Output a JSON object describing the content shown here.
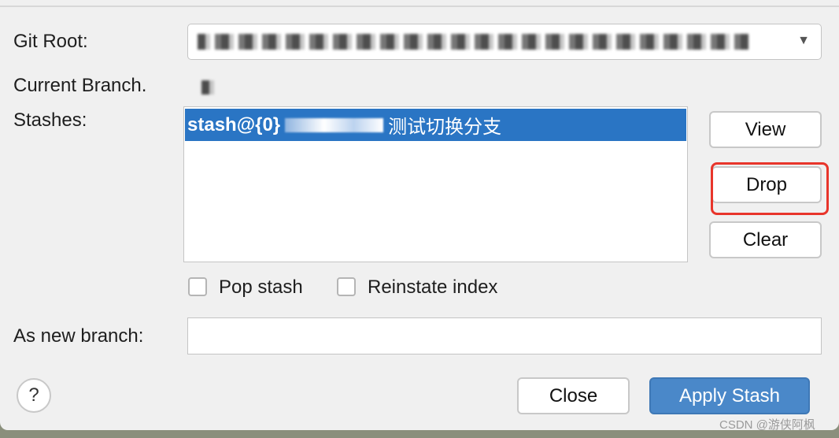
{
  "dialog": {
    "git_root_label": "Git Root:",
    "current_branch_label": "Current Branch.",
    "stashes_label": "Stashes:",
    "stashes": [
      {
        "ref": "stash@{0}",
        "message": "测试切换分支",
        "selected": true
      }
    ],
    "buttons": {
      "view": "View",
      "drop": "Drop",
      "clear": "Clear",
      "close": "Close",
      "apply": "Apply Stash"
    },
    "pop_stash_label": "Pop stash",
    "pop_stash_checked": false,
    "reinstate_index_label": "Reinstate index",
    "reinstate_index_checked": false,
    "new_branch_label": "As new branch:",
    "new_branch_value": "",
    "help_label": "?",
    "highlight_color": "#e8352b",
    "selection_color": "#2a75c4",
    "primary_color": "#4a88c9"
  },
  "watermark": "CSDN @游侠阿枫"
}
